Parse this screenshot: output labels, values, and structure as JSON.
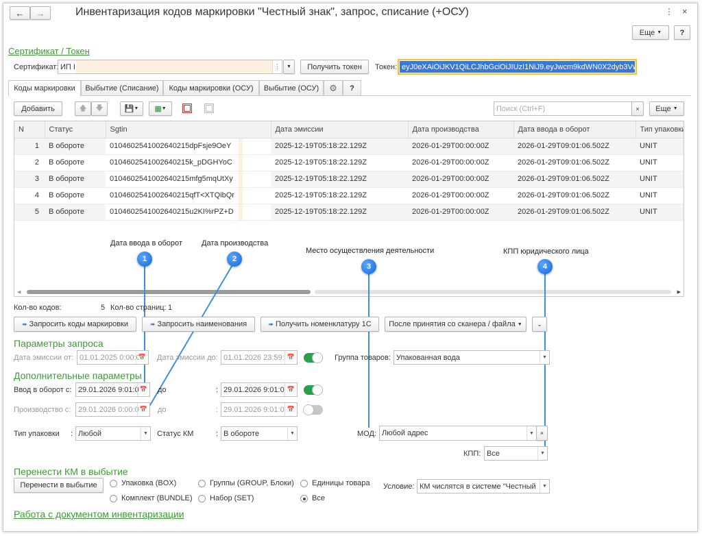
{
  "window": {
    "title": "Инвентаризация кодов маркировки \"Честный знак\", запрос, списание (+ОСУ)",
    "more_label": "Еще",
    "help_label": "?"
  },
  "cert_section": {
    "heading": "Сертификат / Токен",
    "cert_label": "Сертификат:",
    "cert_value": "ИП I",
    "get_token_label": "Получить токен",
    "token_label": "Токен:",
    "token_value": "eyJ0eXAiOiJKV1QiLCJhbGciOiJIUzI1NiJ9.eyJwcm9kdWN0X2dyb3Vw"
  },
  "tabs": [
    "Коды маркировки",
    "Выбытие (Списание)",
    "Коды маркировки (ОСУ)",
    "Выбытие (ОСУ)",
    "?"
  ],
  "toolbar": {
    "add_label": "Добавить",
    "search_placeholder": "Поиск (Ctrl+F)",
    "more_label": "Еще"
  },
  "table": {
    "columns": [
      "N",
      "Статус",
      "Sgtin",
      "Дата эмиссии",
      "Дата производства",
      "Дата ввода в оборот",
      "Тип упаковки"
    ],
    "rows": [
      [
        "1",
        "В обороте",
        "0104602541002640215dpFsje9OeY",
        "2025-12-19T05:18:22.129Z",
        "2026-01-29T00:00:00Z",
        "2026-01-29T09:01:06.502Z",
        "UNIT"
      ],
      [
        "2",
        "В обороте",
        "0104602541002640215k_pDGHYoC",
        "2025-12-19T05:18:22.129Z",
        "2026-01-29T00:00:00Z",
        "2026-01-29T09:01:06.502Z",
        "UNIT"
      ],
      [
        "3",
        "В обороте",
        "0104602541002640215mfg5mqUtXy",
        "2025-12-19T05:18:22.129Z",
        "2026-01-29T00:00:00Z",
        "2026-01-29T09:01:06.502Z",
        "UNIT"
      ],
      [
        "4",
        "В обороте",
        "0104602541002640215qfT<XTQibQr",
        "2025-12-19T05:18:22.129Z",
        "2026-01-29T00:00:00Z",
        "2026-01-29T09:01:06.502Z",
        "UNIT"
      ],
      [
        "5",
        "В обороте",
        "0104602541002640215u2KI%rPZ+D",
        "2025-12-19T05:18:22.129Z",
        "2026-01-29T00:00:00Z",
        "2026-01-29T09:01:06.502Z",
        "UNIT"
      ]
    ]
  },
  "annotations": [
    {
      "num": "1",
      "text": "Дата ввода в оборот"
    },
    {
      "num": "2",
      "text": "Дата производства"
    },
    {
      "num": "3",
      "text": "Место осуществления деятельности"
    },
    {
      "num": "4",
      "text": "КПП юридического лица"
    }
  ],
  "counts": {
    "codes_label": "Кол-во кодов:",
    "codes_value": "5",
    "pages_label": "Кол-во страниц:",
    "pages_value": "1"
  },
  "actions": {
    "request_codes": "Запросить коды маркировки",
    "request_names": "Запросить наименования",
    "get_nomenclature": "Получить номенклатуру 1С",
    "after_scanner": "После принятия со сканера / файла"
  },
  "query_params": {
    "heading": "Параметры запроса",
    "emission_from_label": "Дата эмиссии от:",
    "emission_from": "01.01.2025  0:00:0",
    "emission_to_label": "Дата эмиссии до:",
    "emission_to": "01.01.2026 23:59:",
    "goods_group_label": "Группа товаров:",
    "goods_group": "Упакованная вода"
  },
  "extra_params": {
    "heading": "Дополнительные параметры",
    "circ_from_label": "Ввод в оборот с:",
    "circ_from": "29.01.2026  9:01:0",
    "to_label": "до",
    "circ_to": "29.01.2026  9:01:0",
    "prod_from_label": "Производство с:",
    "prod_from": "29.01.2026  0:00:0",
    "prod_to": "29.01.2026  9:01:0",
    "pack_type_label": "Тип упаковки",
    "pack_type": "Любой",
    "km_status_label": "Статус КМ",
    "km_status": "В обороте",
    "mod_label": "МОД:",
    "mod_value": "Любой адрес",
    "kpp_label": "КПП:",
    "kpp_value": "Все"
  },
  "transfer": {
    "heading": "Перенести КМ в выбытие",
    "button": "Перенести в выбытие",
    "opt_box": "Упаковка (BOX)",
    "opt_group": "Группы (GROUP, Блоки)",
    "opt_unit": "Единицы товара",
    "opt_bundle": "Комплект (BUNDLE)",
    "opt_set": "Набор (SET)",
    "opt_all": "Все",
    "condition_label": "Условие:",
    "condition_value": "КМ числятся в системе \"Честный"
  },
  "inventory_link": "Работа с документом инвентаризации",
  "colors": {
    "accent_green": "#3d9b35",
    "token_border": "#f0c23a",
    "token_bg": "#3a78d6",
    "callout": "#1f74e0",
    "toggle_on": "#2aa04a"
  }
}
